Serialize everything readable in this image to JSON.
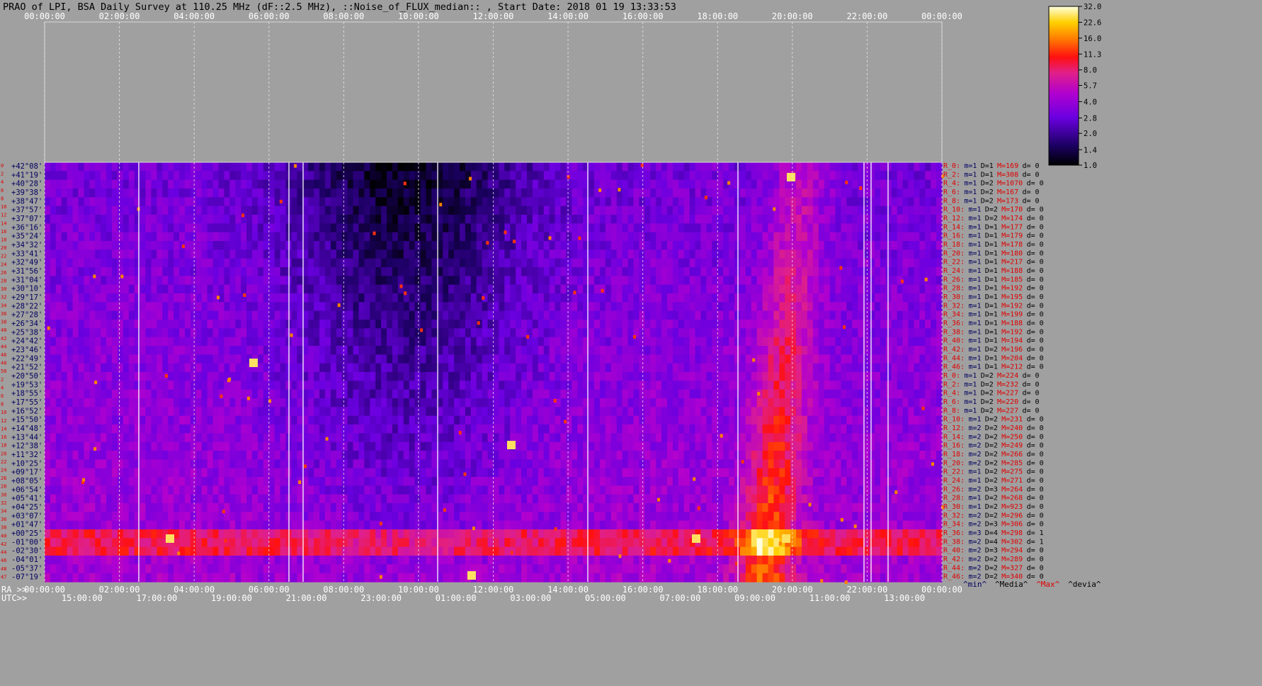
{
  "title": "PRAO of LPI, BSA Daily Survey at 110.25 MHz (dF::2.5 MHz), ::Noise_of_FLUX_median:: , Start Date: 2018 01 19 13:33:53",
  "colors": {
    "background": "#a0a0a0",
    "plot_empty": "#a0a0a0",
    "label_red": "#e00000",
    "label_navy": "#000060",
    "grid": "#d8d8d8"
  },
  "chart_data": {
    "type": "heatmap",
    "colormap": "gnuplot",
    "x_top_ticks": [
      "00:00:00",
      "02:00:00",
      "04:00:00",
      "06:00:00",
      "08:00:00",
      "10:00:00",
      "12:00:00",
      "14:00:00",
      "16:00:00",
      "18:00:00",
      "20:00:00",
      "22:00:00",
      "00:00:00"
    ],
    "x_bottom_ra_label": "RA >>",
    "x_bottom_ra_ticks": [
      "00:00:00",
      "02:00:00",
      "04:00:00",
      "06:00:00",
      "08:00:00",
      "10:00:00",
      "12:00:00",
      "14:00:00",
      "16:00:00",
      "18:00:00",
      "20:00:00",
      "22:00:00",
      "00:00:00"
    ],
    "x_bottom_utc_label": "UTC>>",
    "x_bottom_utc_ticks": [
      "15:00:00",
      "17:00:00",
      "19:00:00",
      "21:00:00",
      "23:00:00",
      "01:00:00",
      "03:00:00",
      "05:00:00",
      "07:00:00",
      "09:00:00",
      "11:00:00",
      "13:00:00"
    ],
    "y_row_numbers": [
      "0",
      "2",
      "4",
      "6",
      "8",
      "10",
      "12",
      "14",
      "16",
      "18",
      "20",
      "22",
      "24",
      "26",
      "28",
      "30",
      "32",
      "34",
      "36",
      "38",
      "40",
      "42",
      "44",
      "46",
      "48",
      "50",
      "2",
      "4",
      "6",
      "8",
      "10",
      "12",
      "14",
      "16",
      "18",
      "20",
      "22",
      "24",
      "26",
      "28",
      "30",
      "32",
      "34",
      "36",
      "38",
      "40",
      "42",
      "44",
      "46",
      "48",
      "47"
    ],
    "declinations": [
      "+42°08'",
      "+41°19'",
      "+40°28'",
      "+39°38'",
      "+38°47'",
      "+37°57'",
      "+37°07'",
      "+36°16'",
      "+35°24'",
      "+34°32'",
      "+33°41'",
      "+32°49'",
      "+31°56'",
      "+31°04'",
      "+30°10'",
      "+29°17'",
      "+28°22'",
      "+27°28'",
      "+26°34'",
      "+25°38'",
      "+24°42'",
      "+23°46'",
      "+22°49'",
      "+21°52'",
      "+20°50'",
      "+19°53'",
      "+18°55'",
      "+17°55'",
      "+16°52'",
      "+15°50'",
      "+14°48'",
      "+13°44'",
      "+12°38'",
      "+11°32'",
      "+10°25'",
      "+09°17'",
      "+08°05'",
      "+06°54'",
      "+05°41'",
      "+04°25'",
      "+03°07'",
      "+01°47'",
      "+00°25'",
      "-01°00'",
      "-02°30'",
      "-04°01'",
      "-05°37'",
      "-07°19'"
    ],
    "right_labels": [
      {
        "r": "R_0:",
        "m": "m=1",
        "D": "D=1",
        "M": "M=169",
        "d": "d= 0"
      },
      {
        "r": "R_2:",
        "m": "m=1",
        "D": "D=1",
        "M": "M=308",
        "d": "d= 0"
      },
      {
        "r": "R_4:",
        "m": "m=1",
        "D": "D=2",
        "M": "M=1070",
        "d": "d= 0"
      },
      {
        "r": "R_6:",
        "m": "m=1",
        "D": "D=2",
        "M": "M=167",
        "d": "d= 0"
      },
      {
        "r": "R_8:",
        "m": "m=1",
        "D": "D=2",
        "M": "M=173",
        "d": "d= 0"
      },
      {
        "r": "R_10:",
        "m": "m=1",
        "D": "D=2",
        "M": "M=170",
        "d": "d= 0"
      },
      {
        "r": "R_12:",
        "m": "m=1",
        "D": "D=2",
        "M": "M=174",
        "d": "d= 0"
      },
      {
        "r": "R_14:",
        "m": "m=1",
        "D": "D=1",
        "M": "M=177",
        "d": "d= 0"
      },
      {
        "r": "R_16:",
        "m": "m=1",
        "D": "D=1",
        "M": "M=179",
        "d": "d= 0"
      },
      {
        "r": "R_18:",
        "m": "m=1",
        "D": "D=1",
        "M": "M=178",
        "d": "d= 0"
      },
      {
        "r": "R_20:",
        "m": "m=1",
        "D": "D=1",
        "M": "M=180",
        "d": "d= 0"
      },
      {
        "r": "R_22:",
        "m": "m=1",
        "D": "D=1",
        "M": "M=217",
        "d": "d= 0"
      },
      {
        "r": "R_24:",
        "m": "m=1",
        "D": "D=1",
        "M": "M=188",
        "d": "d= 0"
      },
      {
        "r": "R_26:",
        "m": "m=1",
        "D": "D=1",
        "M": "M=185",
        "d": "d= 0"
      },
      {
        "r": "R_28:",
        "m": "m=1",
        "D": "D=1",
        "M": "M=192",
        "d": "d= 0"
      },
      {
        "r": "R_30:",
        "m": "m=1",
        "D": "D=1",
        "M": "M=195",
        "d": "d= 0"
      },
      {
        "r": "R_32:",
        "m": "m=1",
        "D": "D=1",
        "M": "M=192",
        "d": "d= 0"
      },
      {
        "r": "R_34:",
        "m": "m=1",
        "D": "D=1",
        "M": "M=199",
        "d": "d= 0"
      },
      {
        "r": "R_36:",
        "m": "m=1",
        "D": "D=1",
        "M": "M=188",
        "d": "d= 0"
      },
      {
        "r": "R_38:",
        "m": "m=1",
        "D": "D=1",
        "M": "M=192",
        "d": "d= 0"
      },
      {
        "r": "R_40:",
        "m": "m=1",
        "D": "D=1",
        "M": "M=194",
        "d": "d= 0"
      },
      {
        "r": "R_42:",
        "m": "m=1",
        "D": "D=2",
        "M": "M=196",
        "d": "d= 0"
      },
      {
        "r": "R_44:",
        "m": "m=1",
        "D": "D=1",
        "M": "M=204",
        "d": "d= 0"
      },
      {
        "r": "R_46:",
        "m": "m=1",
        "D": "D=1",
        "M": "M=212",
        "d": "d= 0"
      },
      {
        "r": "R_0:",
        "m": "m=1",
        "D": "D=2",
        "M": "M=224",
        "d": "d= 0"
      },
      {
        "r": "R_2:",
        "m": "m=1",
        "D": "D=2",
        "M": "M=232",
        "d": "d= 0"
      },
      {
        "r": "R_4:",
        "m": "m=1",
        "D": "D=2",
        "M": "M=227",
        "d": "d= 0"
      },
      {
        "r": "R_6:",
        "m": "m=1",
        "D": "D=2",
        "M": "M=220",
        "d": "d= 0"
      },
      {
        "r": "R_8:",
        "m": "m=1",
        "D": "D=2",
        "M": "M=227",
        "d": "d= 0"
      },
      {
        "r": "R_10:",
        "m": "m=1",
        "D": "D=2",
        "M": "M=231",
        "d": "d= 0"
      },
      {
        "r": "R_12:",
        "m": "m=2",
        "D": "D=2",
        "M": "M=240",
        "d": "d= 0"
      },
      {
        "r": "R_14:",
        "m": "m=2",
        "D": "D=2",
        "M": "M=250",
        "d": "d= 0"
      },
      {
        "r": "R_16:",
        "m": "m=2",
        "D": "D=2",
        "M": "M=249",
        "d": "d= 0"
      },
      {
        "r": "R_18:",
        "m": "m=2",
        "D": "D=2",
        "M": "M=266",
        "d": "d= 0"
      },
      {
        "r": "R_20:",
        "m": "m=2",
        "D": "D=2",
        "M": "M=285",
        "d": "d= 0"
      },
      {
        "r": "R_22:",
        "m": "m=1",
        "D": "D=2",
        "M": "M=275",
        "d": "d= 0"
      },
      {
        "r": "R_24:",
        "m": "m=1",
        "D": "D=2",
        "M": "M=271",
        "d": "d= 0"
      },
      {
        "r": "R_26:",
        "m": "m=2",
        "D": "D=3",
        "M": "M=264",
        "d": "d= 0"
      },
      {
        "r": "R_28:",
        "m": "m=1",
        "D": "D=2",
        "M": "M=268",
        "d": "d= 0"
      },
      {
        "r": "R_30:",
        "m": "m=1",
        "D": "D=2",
        "M": "M=923",
        "d": "d= 0"
      },
      {
        "r": "R_32:",
        "m": "m=2",
        "D": "D=2",
        "M": "M=296",
        "d": "d= 0"
      },
      {
        "r": "R_34:",
        "m": "m=2",
        "D": "D=3",
        "M": "M=306",
        "d": "d= 0"
      },
      {
        "r": "R_36:",
        "m": "m=3",
        "D": "D=4",
        "M": "M=298",
        "d": "d= 1"
      },
      {
        "r": "R_38:",
        "m": "m=2",
        "D": "D=4",
        "M": "M=302",
        "d": "d= 1"
      },
      {
        "r": "R_40:",
        "m": "m=2",
        "D": "D=3",
        "M": "M=294",
        "d": "d= 0"
      },
      {
        "r": "R_42:",
        "m": "m=2",
        "D": "D=2",
        "M": "M=289",
        "d": "d= 0"
      },
      {
        "r": "R_44:",
        "m": "m=2",
        "D": "D=2",
        "M": "M=327",
        "d": "d= 0"
      },
      {
        "r": "R_46:",
        "m": "m=2",
        "D": "D=2",
        "M": "M=340",
        "d": "d= 0"
      }
    ],
    "legend_stats": [
      "^min^",
      "^Media^",
      "^Max^",
      "^devia^"
    ],
    "colorbar": {
      "ticks": [
        "32.0",
        "22.6",
        "16.0",
        "11.3",
        "8.0",
        "5.7",
        "4.0",
        "2.8",
        "2.0",
        "1.4",
        "1.0"
      ],
      "min": 1.0,
      "max": 32.0,
      "scale": "log"
    }
  }
}
